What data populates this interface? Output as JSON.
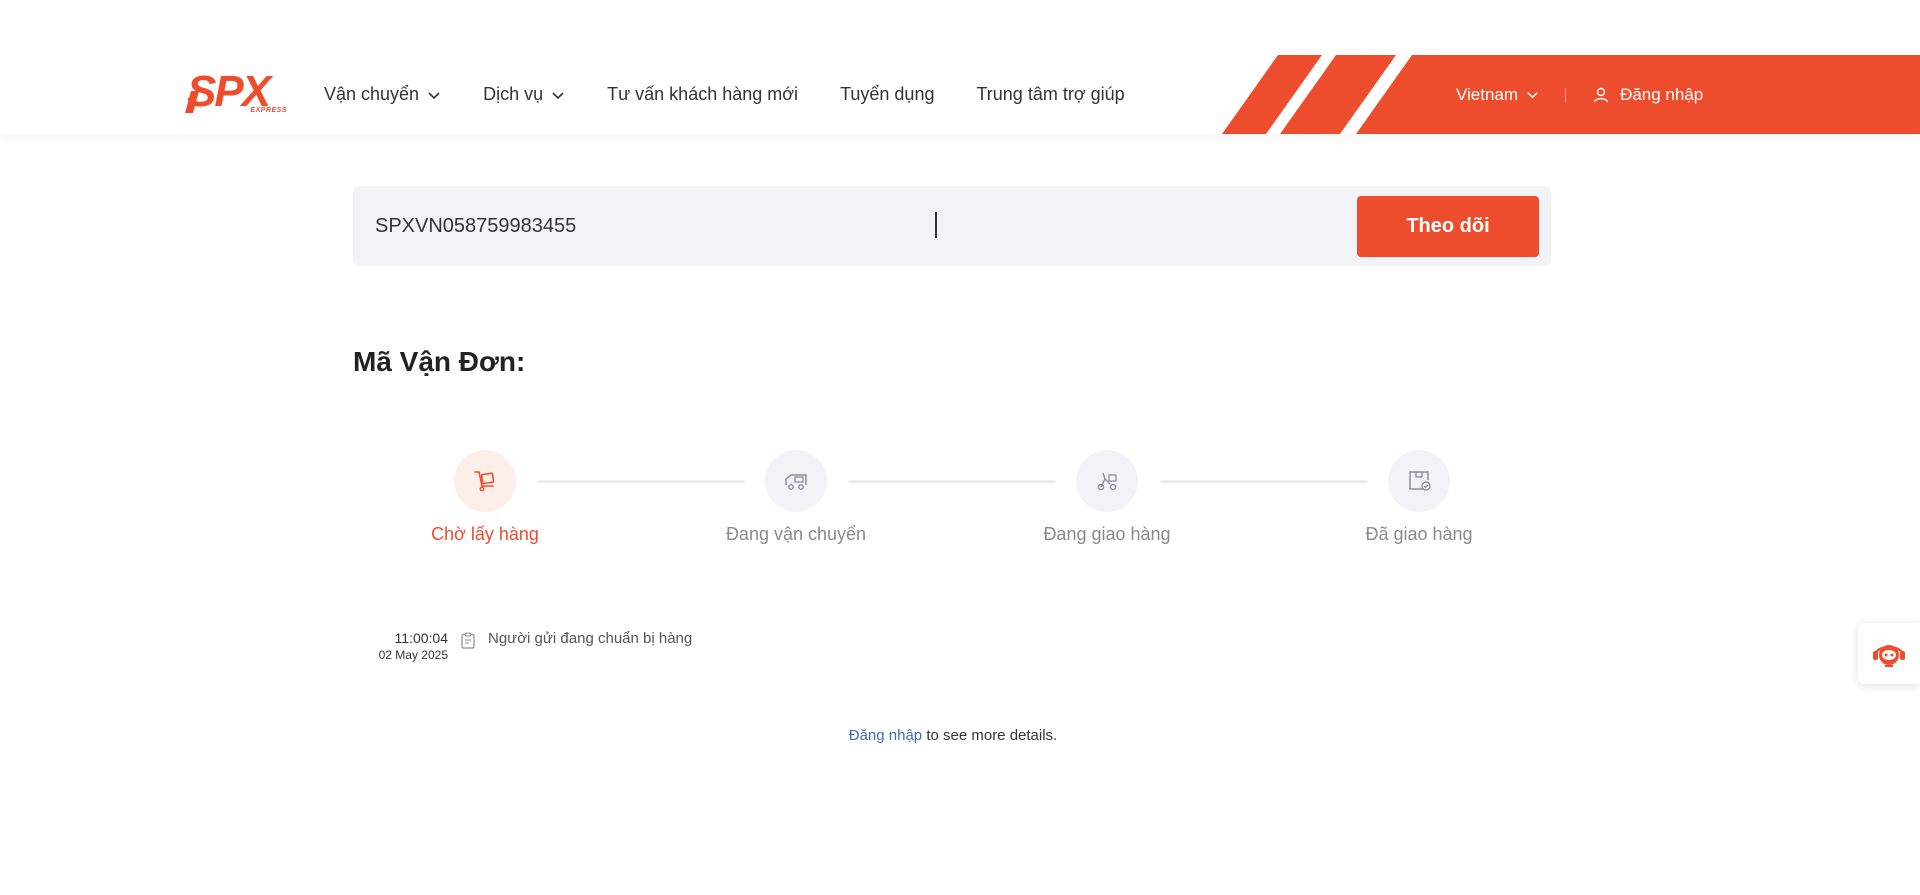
{
  "brand": {
    "logo_text": "SPX",
    "logo_sub": "EXPRESS",
    "accent": "#ee4d2d"
  },
  "nav": {
    "items": [
      {
        "label": "Vận chuyển",
        "has_dropdown": true
      },
      {
        "label": "Dịch vụ",
        "has_dropdown": true
      },
      {
        "label": "Tư vấn khách hàng mới",
        "has_dropdown": false
      },
      {
        "label": "Tuyển dụng",
        "has_dropdown": false
      },
      {
        "label": "Trung tâm trợ giúp",
        "has_dropdown": false
      }
    ],
    "language": "Vietnam",
    "login_label": "Đăng nhập"
  },
  "search": {
    "value": "SPXVN058759983455",
    "button_label": "Theo dõi"
  },
  "waybill": {
    "title": "Mã Vận Đơn:"
  },
  "steps": [
    {
      "label": "Chờ lấy hàng",
      "icon": "cart-icon",
      "active": true
    },
    {
      "label": "Đang vận chuyển",
      "icon": "truck-icon",
      "active": false
    },
    {
      "label": "Đang giao hàng",
      "icon": "scooter-icon",
      "active": false
    },
    {
      "label": "Đã giao hàng",
      "icon": "box-check-icon",
      "active": false
    }
  ],
  "events": [
    {
      "time": "11:00:04",
      "date": "02 May 2025",
      "description": "Người gửi đang chuẩn bị hàng",
      "icon": "clipboard-icon"
    }
  ],
  "more_details": {
    "link_label": "Đăng nhập",
    "suffix": " to see more details."
  }
}
